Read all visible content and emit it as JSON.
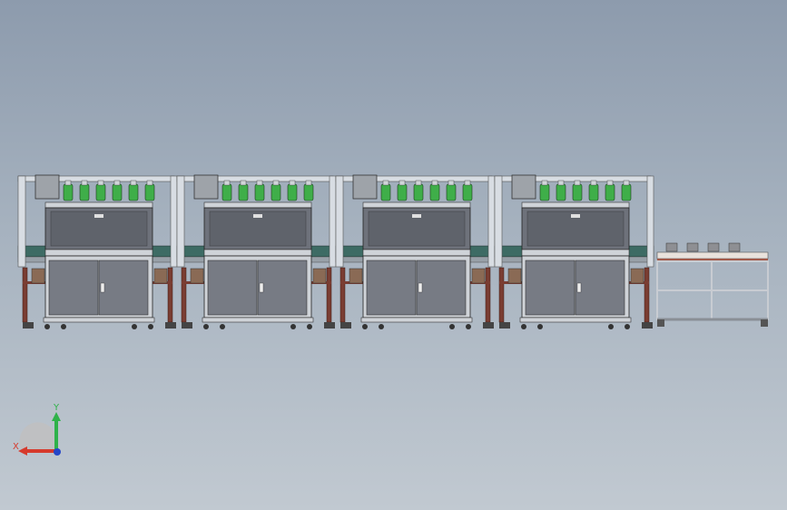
{
  "viewport": {
    "background_top": "#8d9bad",
    "background_bottom": "#c1c9d1"
  },
  "model": {
    "stations": 4,
    "bottles_per_station": 6,
    "rack_caps": 4,
    "colors": {
      "frame": "#d8dde3",
      "panel": "#6e727b",
      "door": "#777b84",
      "bottle": "#3fae49",
      "leg": "#7a3d32",
      "belt": "#3d6b64"
    }
  },
  "triad": {
    "x_label": "X",
    "y_label": "Y",
    "x_color": "#d63a2c",
    "y_color": "#2fb24a",
    "z_color": "#2446c8",
    "icon": "coordinate-triad-icon"
  }
}
